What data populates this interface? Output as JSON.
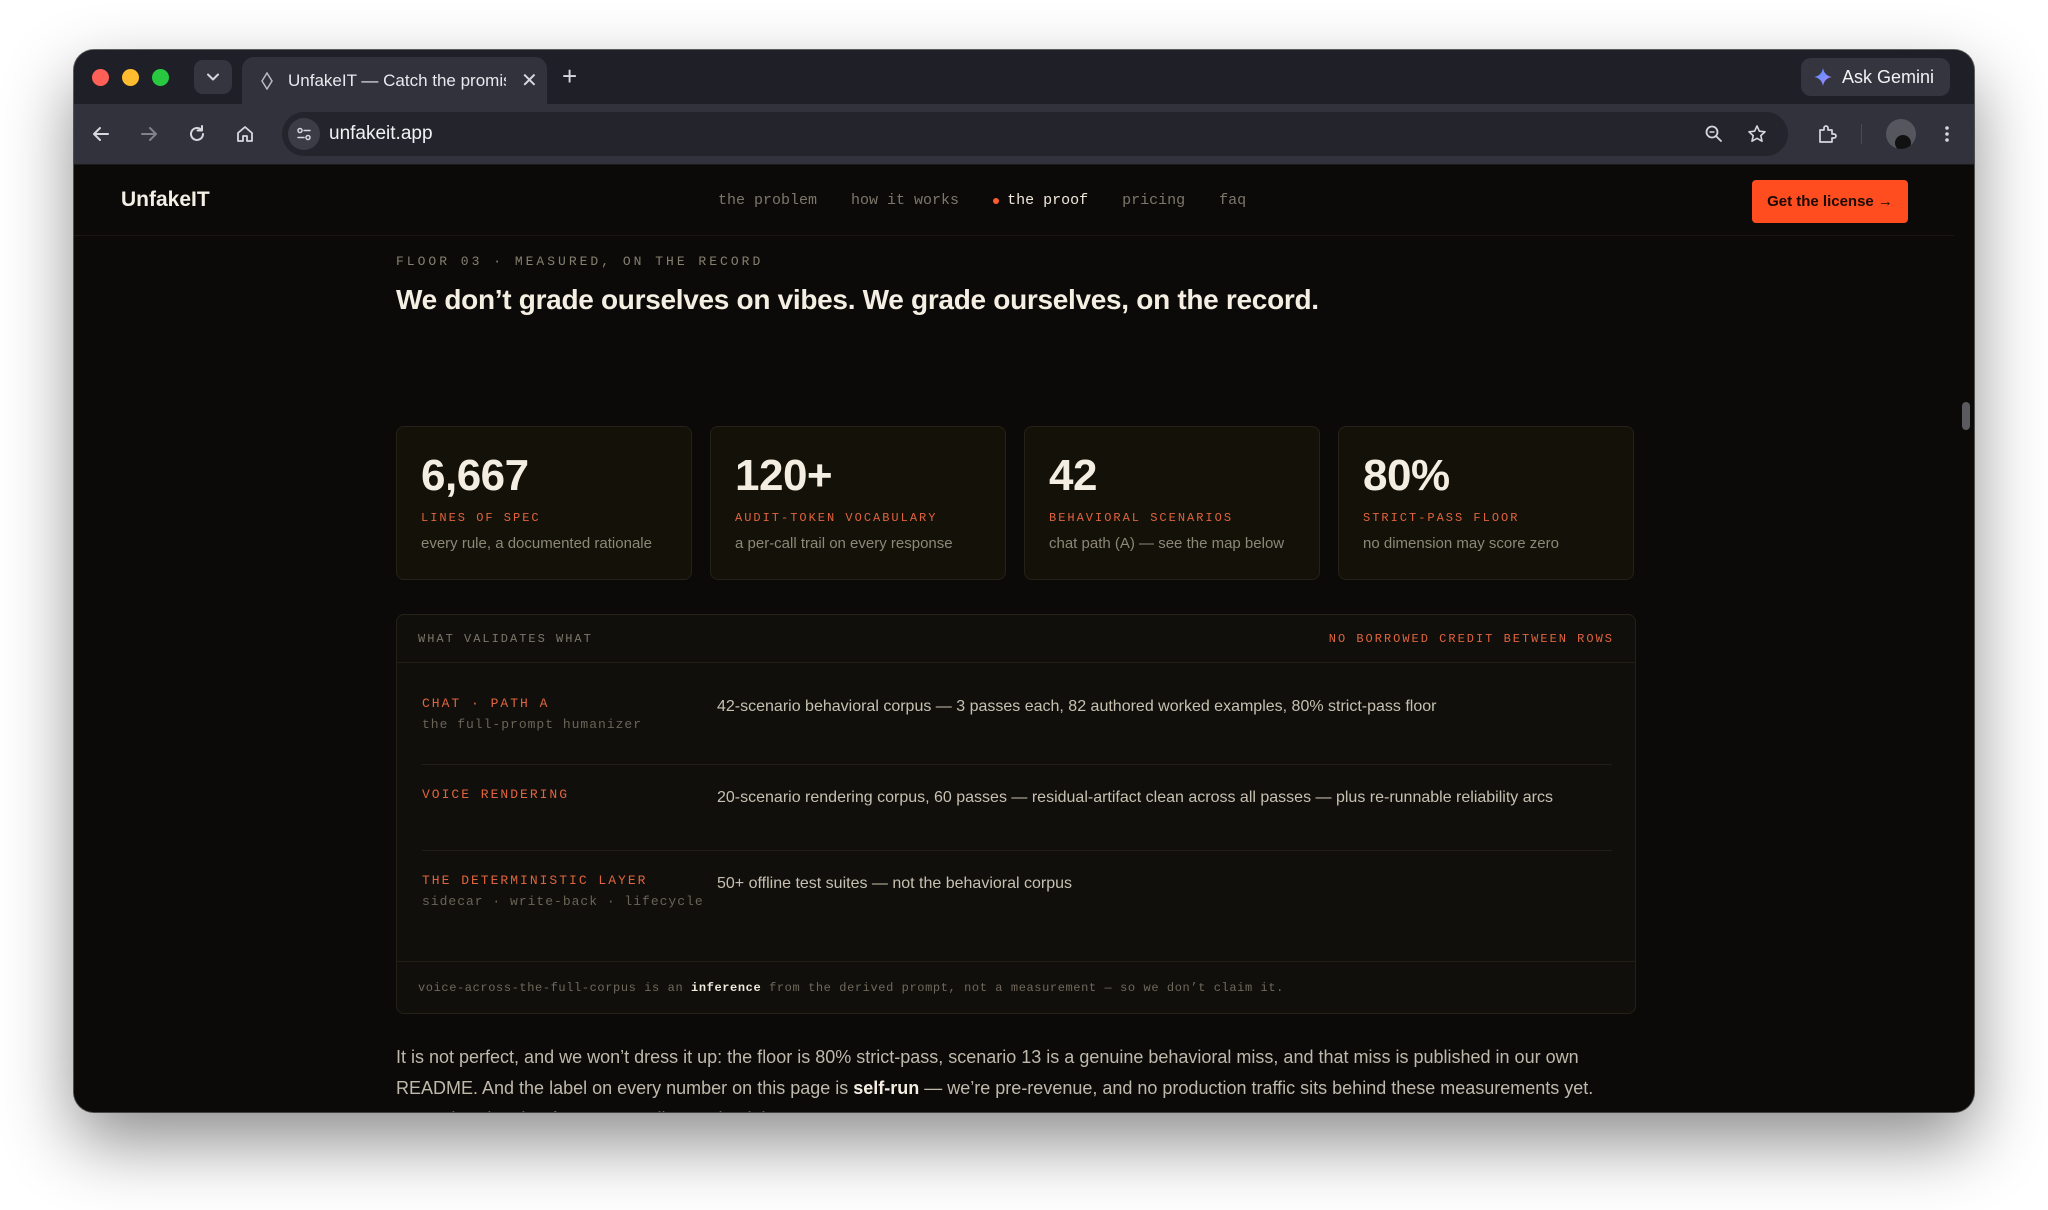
{
  "browser": {
    "tab_title": "UnfakeIT — Catch the promis",
    "url": "unfakeit.app",
    "ask_gemini_label": "Ask Gemini"
  },
  "site": {
    "brand": "UnfakeIT",
    "nav": [
      {
        "label": "the problem"
      },
      {
        "label": "how it works"
      },
      {
        "label": "the proof"
      },
      {
        "label": "pricing"
      },
      {
        "label": "faq"
      }
    ],
    "active_nav": "the proof",
    "cta_label": "Get the license →"
  },
  "section": {
    "eyebrow": "FLOOR 03 · MEASURED, ON THE RECORD",
    "headline": "We don’t grade ourselves on vibes. We grade ourselves, on the record."
  },
  "stats": [
    {
      "value": "6,667",
      "label": "LINES OF SPEC",
      "desc": "every rule, a documented rationale"
    },
    {
      "value": "120+",
      "label": "AUDIT-TOKEN VOCABULARY",
      "desc": "a per-call trail on every response"
    },
    {
      "value": "42",
      "label": "BEHAVIORAL SCENARIOS",
      "desc": "chat path (A) — see the map below"
    },
    {
      "value": "80%",
      "label": "STRICT-PASS FLOOR",
      "desc": "no dimension may score zero"
    }
  ],
  "validation": {
    "header_left": "WHAT VALIDATES WHAT",
    "header_right": "NO BORROWED CREDIT BETWEEN ROWS",
    "rows": [
      {
        "name": "CHAT · PATH A",
        "sub": "the full-prompt humanizer",
        "text": "42-scenario behavioral corpus — 3 passes each, 82 authored worked examples, 80% strict-pass floor"
      },
      {
        "name": "VOICE RENDERING",
        "sub": "",
        "text": "20-scenario rendering corpus, 60 passes — residual-artifact clean across all passes — plus re-runnable reliability arcs"
      },
      {
        "name": "THE DETERMINISTIC LAYER",
        "sub": "sidecar · write-back · lifecycle",
        "text": "50+ offline test suites — not the behavioral corpus"
      }
    ],
    "footer_pre": "voice-across-the-full-corpus is an ",
    "footer_bold": "inference",
    "footer_post": " from the derived prompt, not a measurement — so we don’t claim it."
  },
  "closing": {
    "part1": "It is not perfect, and we won’t dress it up: the floor is 80% strict-pass, scenario 13 is a genuine behavioral miss, and that miss is published in our own README. And the label on every number on this page is ",
    "bold": "self-run",
    "part2": " — we’re pre-revenue, and no production traffic sits behind these measurements yet. You’re hearing that from us, not discovering it later."
  },
  "colors": {
    "accent": "#ff4d1f",
    "label_orange": "#e0643e",
    "page_bg": "#0b0a08"
  }
}
